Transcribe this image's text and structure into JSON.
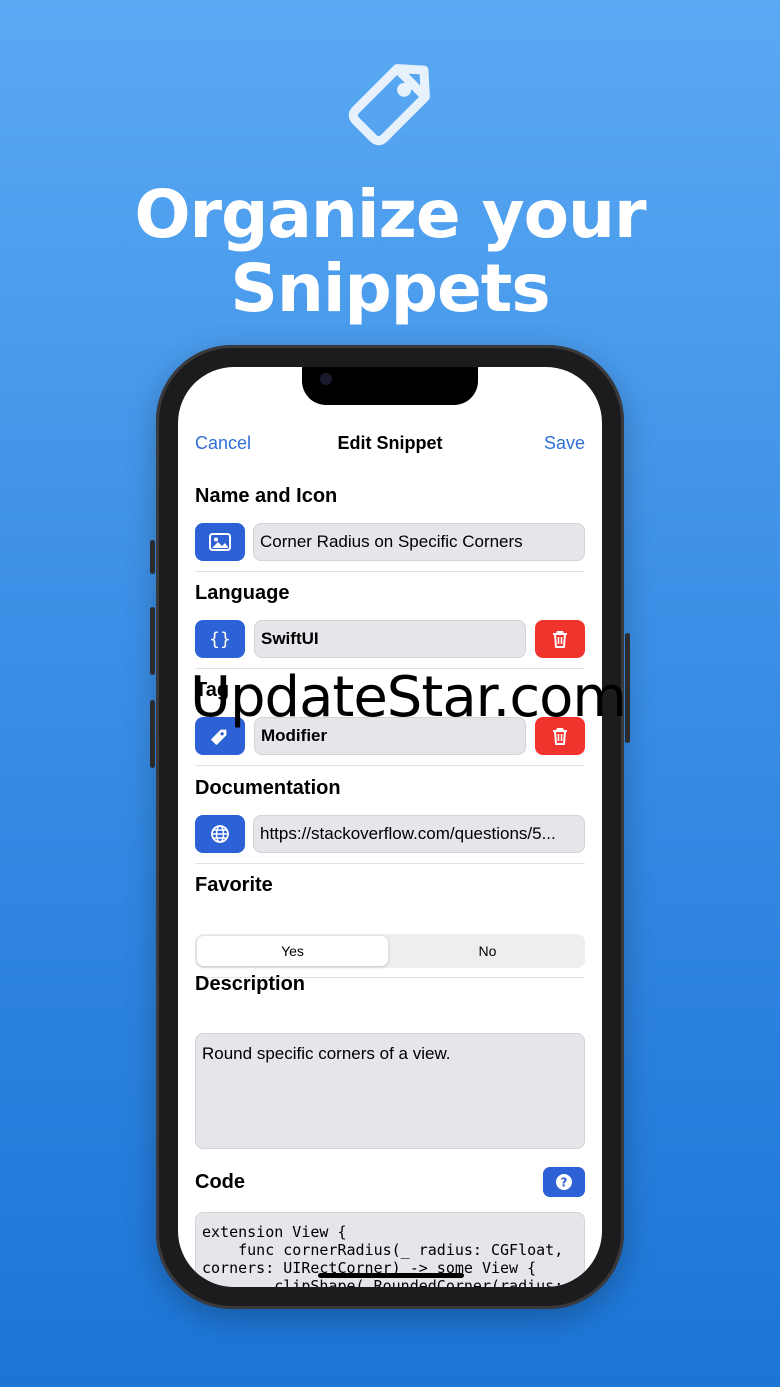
{
  "hero": {
    "title_line1": "Organize your",
    "title_line2": "Snippets",
    "icon": "tag-icon"
  },
  "nav": {
    "cancel": "Cancel",
    "title": "Edit Snippet",
    "save": "Save"
  },
  "name_section": {
    "heading": "Name and Icon",
    "value": "Corner Radius on Specific Corners",
    "icon": "photo-icon"
  },
  "language_section": {
    "heading": "Language",
    "value": "SwiftUI",
    "icon": "braces-icon"
  },
  "tag_section": {
    "heading": "Tag",
    "value": "Modifier",
    "icon": "tag-icon"
  },
  "documentation_section": {
    "heading": "Documentation",
    "value": "https://stackoverflow.com/questions/5...",
    "icon": "globe-icon"
  },
  "favorite_section": {
    "heading": "Favorite",
    "options": [
      "Yes",
      "No"
    ],
    "selected": "Yes"
  },
  "description_section": {
    "heading": "Description",
    "value": "Round specific corners of a view."
  },
  "code_section": {
    "heading": "Code",
    "value": "extension View {\n    func cornerRadius(_ radius: CGFloat,\ncorners: UIRectCorner) -> some View {\n        clipShape( RoundedCorner(radius:\nradius, corners: corners) )"
  },
  "watermark": "UpdateStar.com",
  "colors": {
    "accent": "#2d62d6",
    "destructive": "#f0332c",
    "link": "#2f6fd6",
    "background_top": "#5aa9f3",
    "background_bottom": "#1c75d6"
  }
}
